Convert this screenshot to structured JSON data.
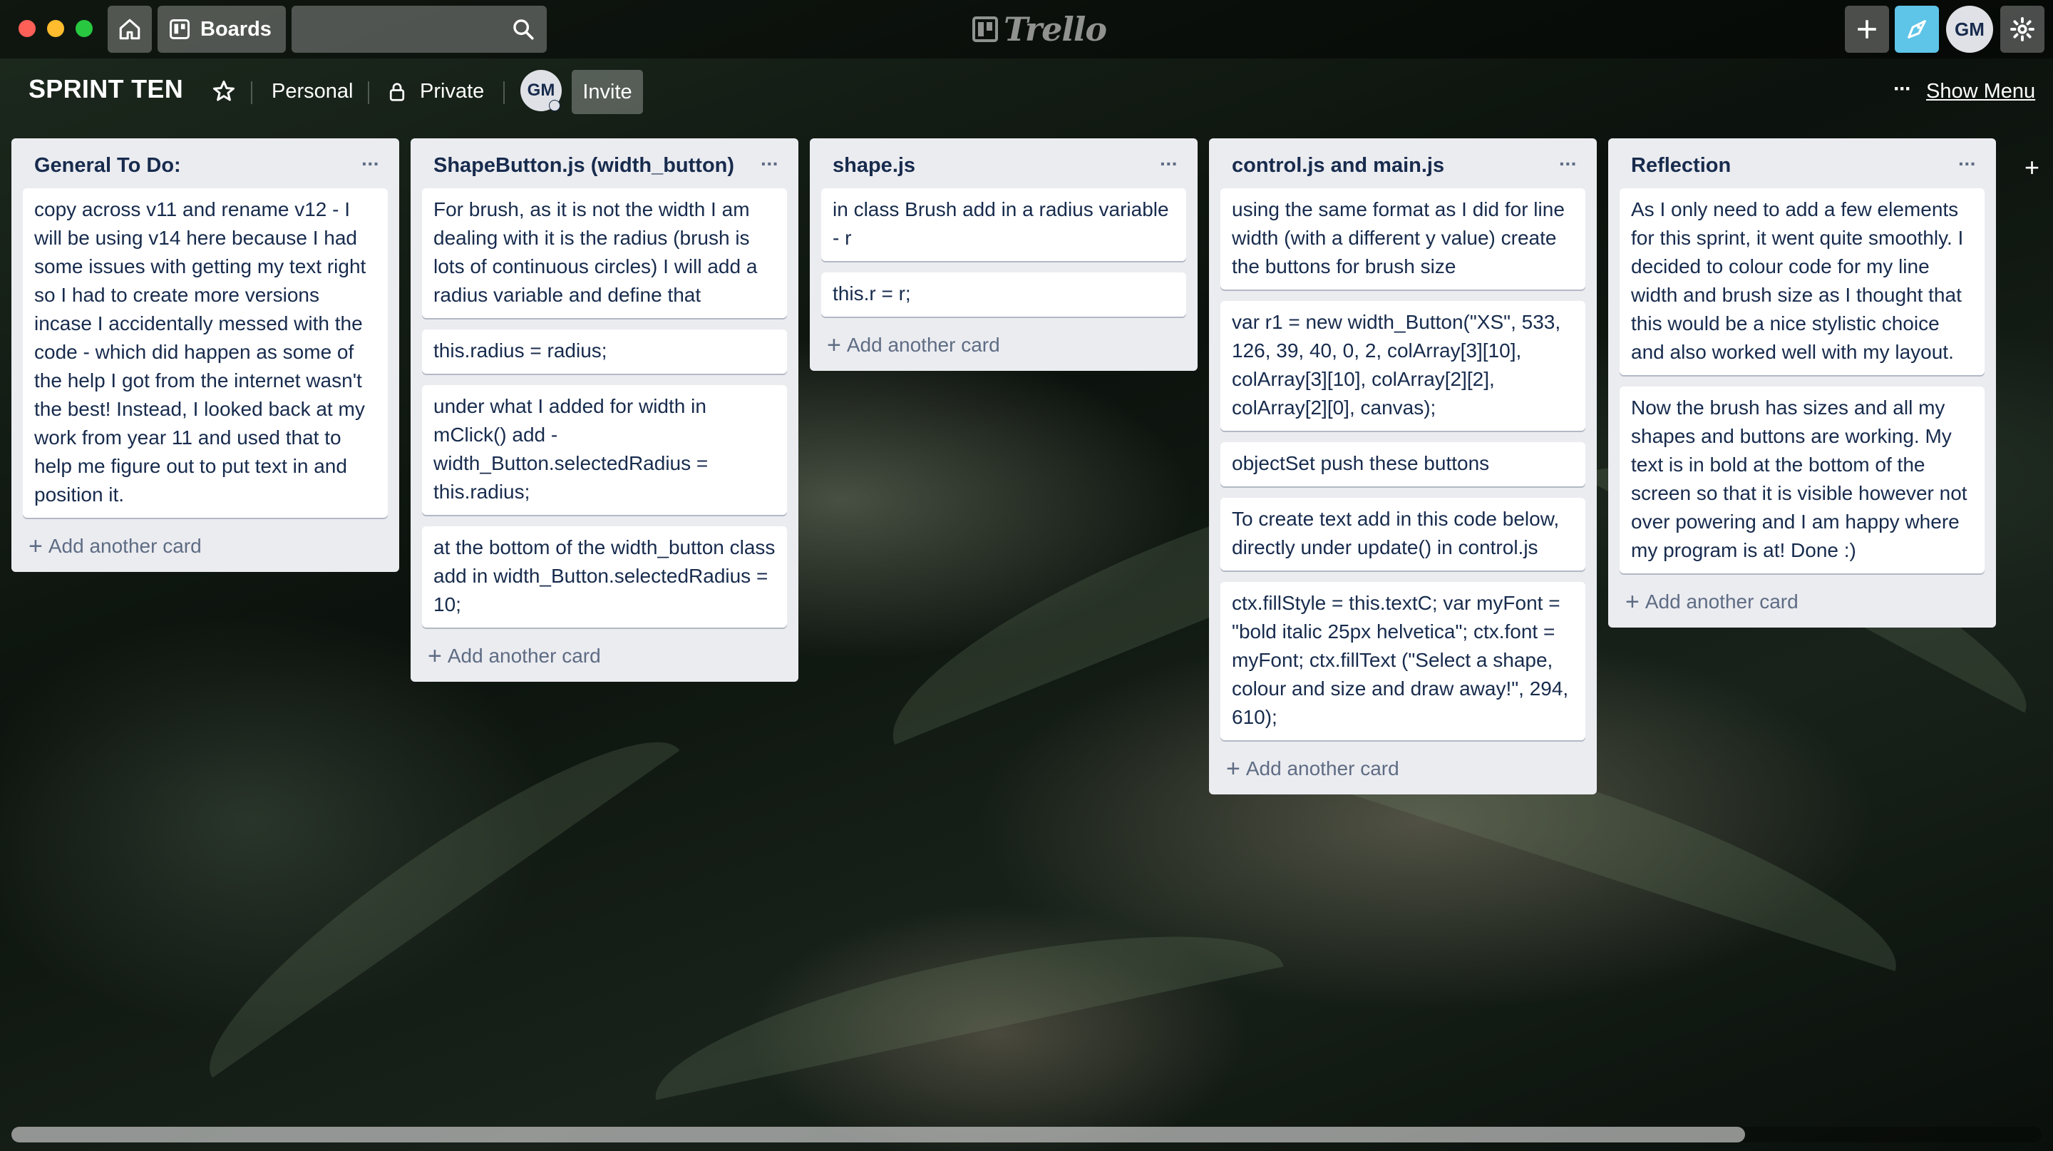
{
  "topbar": {
    "boards_label": "Boards",
    "search_placeholder": "",
    "logo_text": "Trello",
    "user_initials": "GM"
  },
  "board": {
    "title": "SPRINT TEN",
    "visibility_team": "Personal",
    "visibility_privacy": "Private",
    "member_initials": "GM",
    "invite_label": "Invite",
    "show_menu_label": "Show Menu",
    "add_card_label": "Add another card"
  },
  "lists": [
    {
      "title": "General To Do:",
      "cards": [
        "copy across v11 and rename v12 - I will be using v14 here because I had some issues with getting my text right so I had to create more versions incase I accidentally messed with the code - which did happen as some of the help I got from the internet wasn't the best! Instead, I looked back at my work from year 11 and used that to help me figure out to put text in and position it."
      ]
    },
    {
      "title": "ShapeButton.js (width_button)",
      "cards": [
        "For brush, as it is not the width I am dealing with it is the radius (brush is lots of continuous circles) I will add a radius variable and define that",
        "this.radius = radius;",
        "under what I added for width in mClick() add - width_Button.selectedRadius = this.radius;",
        "at the bottom of the width_button class add in width_Button.selectedRadius = 10;"
      ]
    },
    {
      "title": "shape.js",
      "cards": [
        "in class Brush add in a radius variable - r",
        "this.r = r;"
      ]
    },
    {
      "title": "control.js and main.js",
      "cards": [
        "using the same format as I did for line width (with a different y value) create the buttons for brush size",
        "var r1 = new width_Button(\"XS\", 533, 126, 39, 40, 0, 2, colArray[3][10], colArray[3][10], colArray[2][2], colArray[2][0], canvas);",
        "objectSet push these buttons",
        "To create text add in this code below, directly under update() in control.js",
        "ctx.fillStyle = this.textC; var myFont = \"bold italic 25px helvetica\"; ctx.font = myFont; ctx.fillText (\"Select a shape, colour and size and draw away!\", 294, 610);"
      ]
    },
    {
      "title": "Reflection",
      "cards": [
        "As I only need to add a few elements for this sprint, it went quite smoothly. I decided to colour code for my line width and brush size as I thought that this would be a nice stylistic choice and also worked well with my layout.",
        "Now the brush has sizes and all my shapes and buttons are working. My text is in bold at the bottom of the screen so that it is visible however not over powering and I am happy where my program is at! Done :)"
      ]
    }
  ],
  "icons": {
    "home": "home-icon",
    "boards": "board-icon",
    "search": "search-icon",
    "plus": "plus-icon",
    "tip": "tip-icon",
    "gear": "gear-icon",
    "star": "star-icon",
    "lock": "lock-icon",
    "more": "more-icon"
  },
  "colors": {
    "list_bg": "#ebecf0",
    "card_bg": "#ffffff",
    "text": "#172b4d",
    "muted": "#5e6c84",
    "tip_accent": "#5ec4e8"
  }
}
